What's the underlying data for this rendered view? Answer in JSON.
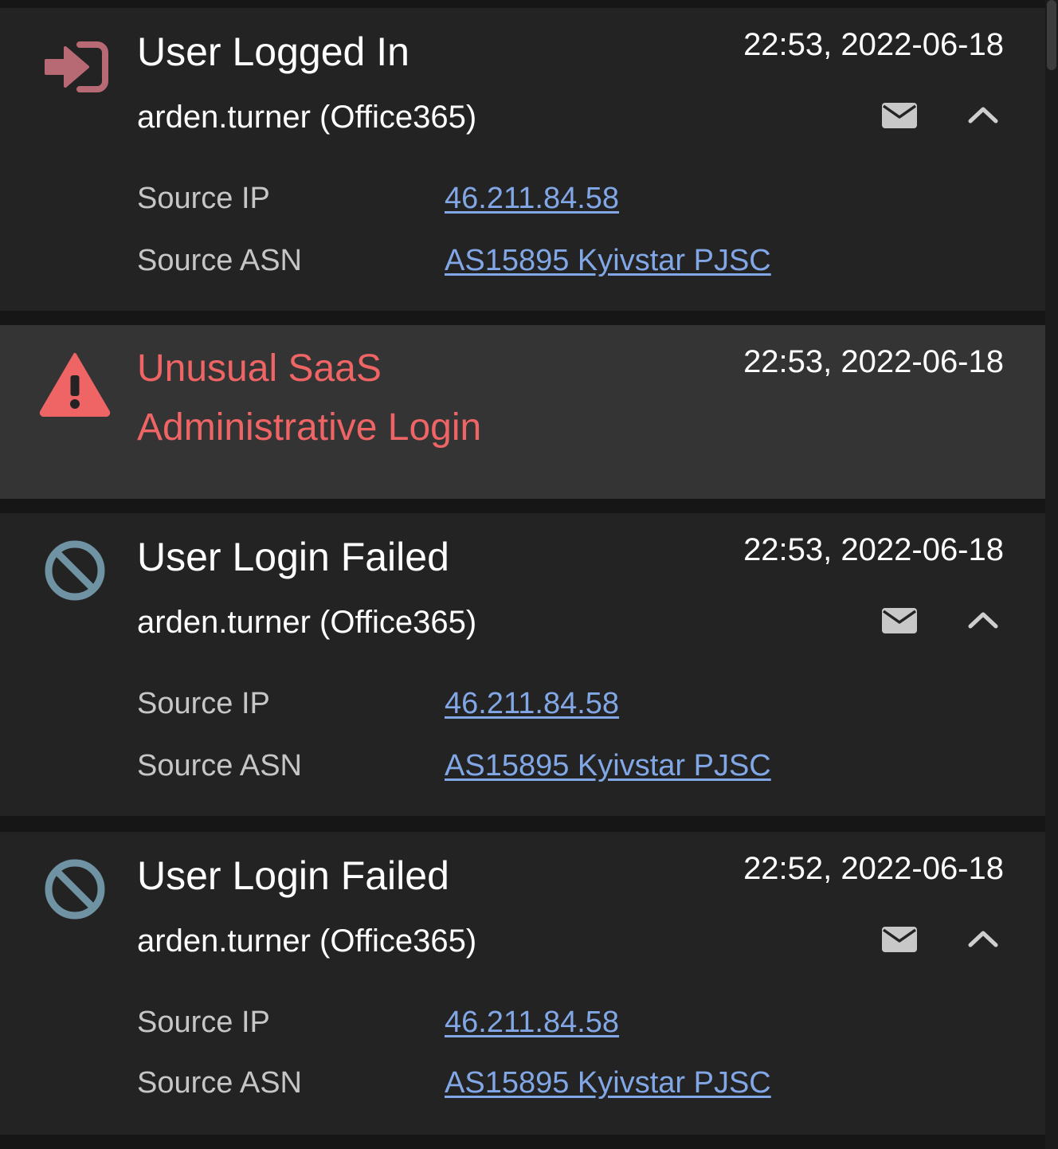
{
  "colors": {
    "page_bg": "#161616",
    "card_bg": "#232323",
    "alert_card_bg": "#343434",
    "alert_red": "#ef6464",
    "login_icon": "#b86a74",
    "blocked_icon": "#6f93a3",
    "link": "#82a7e6",
    "label": "#c6c6c6"
  },
  "events": [
    {
      "type": "event",
      "icon": "login-icon",
      "title": "User Logged In",
      "timestamp": "22:53, 2022-06-18",
      "user": "arden.turner (Office365)",
      "email_icon": "envelope-icon",
      "collapse_icon": "chevron-up-icon",
      "details": [
        {
          "label": "Source IP",
          "value": "46.211.84.58"
        },
        {
          "label": "Source ASN",
          "value": "AS15895 Kyivstar PJSC"
        }
      ]
    },
    {
      "type": "alert",
      "icon": "warning-triangle-icon",
      "title_line1": "Unusual SaaS",
      "title_line2": "Administrative Login",
      "timestamp": "22:53, 2022-06-18"
    },
    {
      "type": "event",
      "icon": "blocked-icon",
      "title": "User Login Failed",
      "timestamp": "22:53, 2022-06-18",
      "user": "arden.turner (Office365)",
      "email_icon": "envelope-icon",
      "collapse_icon": "chevron-up-icon",
      "details": [
        {
          "label": "Source IP",
          "value": "46.211.84.58"
        },
        {
          "label": "Source ASN",
          "value": "AS15895 Kyivstar PJSC"
        }
      ]
    },
    {
      "type": "event",
      "icon": "blocked-icon",
      "title": "User Login Failed",
      "timestamp": "22:52, 2022-06-18",
      "user": "arden.turner (Office365)",
      "email_icon": "envelope-icon",
      "collapse_icon": "chevron-up-icon",
      "details": [
        {
          "label": "Source IP",
          "value": "46.211.84.58"
        },
        {
          "label": "Source ASN",
          "value": "AS15895 Kyivstar PJSC"
        }
      ]
    }
  ]
}
